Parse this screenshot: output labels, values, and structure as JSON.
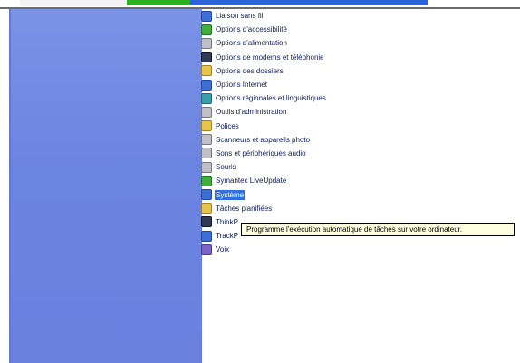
{
  "items": [
    {
      "label": "Liaison sans fil",
      "icon": "wireless-icon",
      "color": "i-blue"
    },
    {
      "label": "Options d'accessibilité",
      "icon": "accessibility-icon",
      "color": "i-green"
    },
    {
      "label": "Options d'alimentation",
      "icon": "power-options-icon",
      "color": "i-gray"
    },
    {
      "label": "Options de modems et téléphonie",
      "icon": "modem-phone-icon",
      "color": "i-dark"
    },
    {
      "label": "Options des dossiers",
      "icon": "folder-options-icon",
      "color": "i-yellow"
    },
    {
      "label": "Options Internet",
      "icon": "internet-options-icon",
      "color": "i-blue"
    },
    {
      "label": "Options régionales et linguistiques",
      "icon": "regional-options-icon",
      "color": "i-teal"
    },
    {
      "label": "Outils d'administration",
      "icon": "admin-tools-icon",
      "color": "i-gray"
    },
    {
      "label": "Polices",
      "icon": "fonts-folder-icon",
      "color": "i-yellow"
    },
    {
      "label": "Scanneurs et appareils photo",
      "icon": "scanner-camera-icon",
      "color": "i-gray"
    },
    {
      "label": "Sons et périphériques audio",
      "icon": "sound-icon",
      "color": "i-gray"
    },
    {
      "label": "Souris",
      "icon": "mouse-icon",
      "color": "i-gray"
    },
    {
      "label": "Symantec LiveUpdate",
      "icon": "liveupdate-icon",
      "color": "i-green"
    },
    {
      "label": "Système",
      "icon": "system-icon",
      "color": "i-blue",
      "selected": true
    },
    {
      "label": "Tâches planifiées",
      "icon": "scheduled-tasks-icon",
      "color": "i-yellow"
    },
    {
      "label": "ThinkP",
      "icon": "thinkpad-icon",
      "color": "i-dark"
    },
    {
      "label": "TrackP",
      "icon": "trackpoint-icon",
      "color": "i-blue"
    },
    {
      "label": "Voix",
      "icon": "speech-icon",
      "color": "i-purple"
    }
  ],
  "tooltip": {
    "text": "Programme l'exécution automatique de tâches sur votre ordinateur."
  }
}
